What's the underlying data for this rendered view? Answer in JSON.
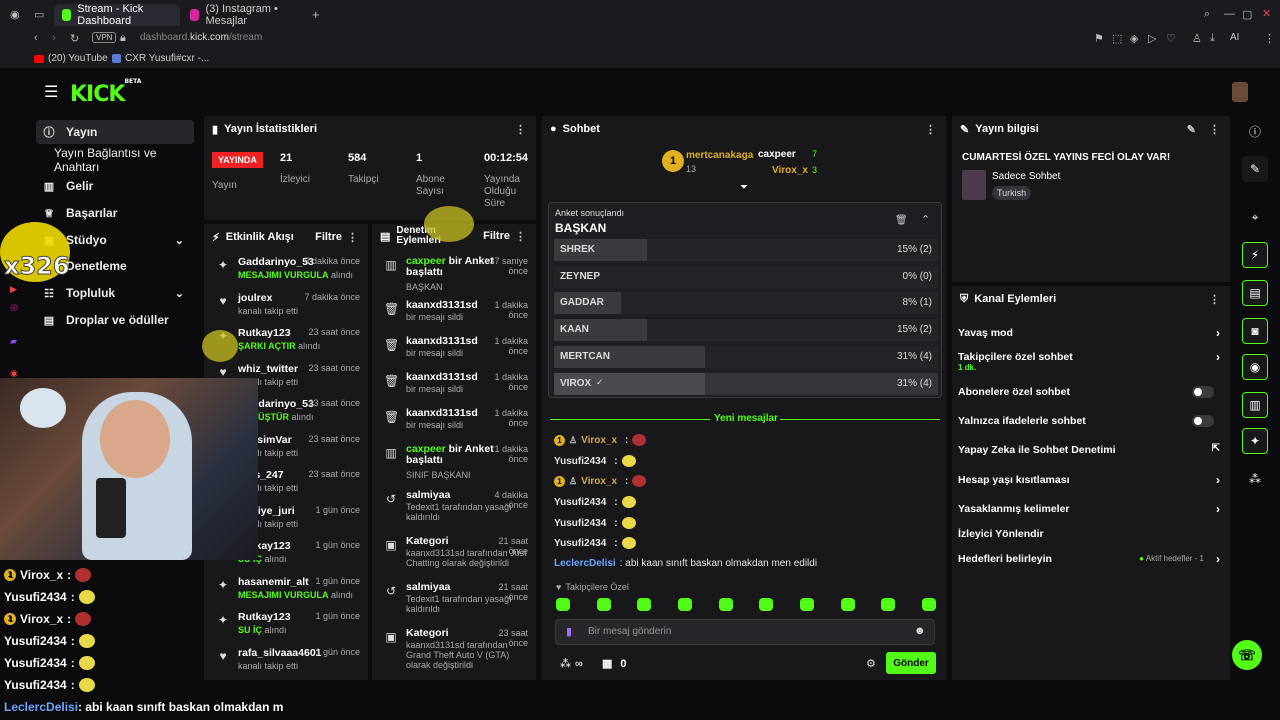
{
  "browser": {
    "tabs": [
      {
        "label": "Stream - Kick Dashboard",
        "active": true,
        "color": "#53fc18"
      },
      {
        "label": "(3) Instagram • Mesajlar",
        "active": false,
        "color": "#d6249f"
      }
    ],
    "vpn": "VPN",
    "url_host": "dashboard.",
    "url_domain": "kick.com",
    "url_path": "/stream",
    "ai_label": "AI",
    "bookmarks": [
      "(20) YouTube",
      "CXR Yusufi#cxr -..."
    ]
  },
  "kick": {
    "logo": "KICK",
    "beta": "BETA"
  },
  "sidebar": {
    "items": [
      {
        "label": "Yayın",
        "icon": "info-icon"
      },
      {
        "label": "Yayın Bağlantısı ve Anahtarı",
        "icon": ""
      },
      {
        "label": "Gelir",
        "icon": "chart-icon"
      },
      {
        "label": "Başarılar",
        "icon": "trophy-icon"
      },
      {
        "label": "Stüdyo",
        "icon": "studio-icon"
      },
      {
        "label": "Denetleme",
        "icon": "shield-icon"
      },
      {
        "label": "Topluluk",
        "icon": "community-icon"
      },
      {
        "label": "Droplar ve ödüller",
        "icon": "gift-icon"
      }
    ]
  },
  "stats": {
    "title": "Yayın İstatistikleri",
    "live_badge": "YAYINDA",
    "live_label": "Yayın",
    "items": [
      {
        "value": "21",
        "label": "İzleyici"
      },
      {
        "value": "584",
        "label": "Takipçi"
      },
      {
        "value": "1",
        "label": "Abone Sayısı"
      },
      {
        "value": "00:12:54",
        "label": "Yayında Olduğu Süre"
      }
    ]
  },
  "activity": {
    "title": "Etkinlik Akışı",
    "filter": "Filtre",
    "rows": [
      {
        "name": "Gaddarinyo_53",
        "time": "5 dakika önce",
        "sub": "MESAJIMI VURGULA",
        "sub2": " alındı",
        "icon": "gift-icon"
      },
      {
        "name": "joulrex",
        "time": "7 dakika önce",
        "sub": "",
        "sub2": "kanalı takip etti",
        "icon": "heart-icon"
      },
      {
        "name": "Rutkay123",
        "time": "23 saat önce",
        "sub": "ŞARKI AÇTIR",
        "sub2": " alındı",
        "icon": "gift-icon"
      },
      {
        "name": "whiz_twitter",
        "time": "23 saat önce",
        "sub": "",
        "sub2": "kanalı takip etti",
        "icon": "heart-icon"
      },
      {
        "name": "Gaddarinyo_53",
        "time": "23 saat önce",
        "sub": "DÖNÜŞTÜR",
        "sub2": " alındı",
        "icon": "gift-icon"
      },
      {
        "name": "PipisimVar",
        "time": "23 saat önce",
        "sub": "",
        "sub2": "kanalı takip etti",
        "icon": "heart-icon"
      },
      {
        "name": "ross_247",
        "time": "23 saat önce",
        "sub": "",
        "sub2": "kanalı takip etti",
        "icon": "heart-icon"
      },
      {
        "name": "turkiye_juri",
        "time": "1 gün önce",
        "sub": "",
        "sub2": "kanalı takip etti",
        "icon": "heart-icon"
      },
      {
        "name": "Rutkay123",
        "time": "1 gün önce",
        "sub": "SU İÇ",
        "sub2": " alındı",
        "icon": "gift-icon"
      },
      {
        "name": "hasanemir_alt",
        "time": "1 gün önce",
        "sub": "MESAJIMI VURGULA",
        "sub2": " alındı",
        "icon": "gift-icon"
      },
      {
        "name": "Rutkay123",
        "time": "1 gün önce",
        "sub": "SU İÇ",
        "sub2": " alındı",
        "icon": "gift-icon"
      },
      {
        "name": "rafa_silvaaa4601",
        "time": "1 gün önce",
        "sub": "",
        "sub2": "kanalı takip etti",
        "icon": "heart-icon"
      }
    ]
  },
  "moderation": {
    "title": "Denetim Eylemleri",
    "filter": "Filtre",
    "rows": [
      {
        "name": "caxpeer",
        "rest": " bir Anket başlattı",
        "time": "37 saniye önce",
        "sub": "BAŞKAN",
        "icon": "poll-icon",
        "h": 44
      },
      {
        "name": "kaanxd3131sd",
        "rest": "",
        "time": "1 dakika önce",
        "sub": "bir mesajı sildi",
        "icon": "trash-icon",
        "h": 36
      },
      {
        "name": "kaanxd3131sd",
        "rest": "",
        "time": "1 dakika önce",
        "sub": "bir mesajı sildi",
        "icon": "trash-icon",
        "h": 36
      },
      {
        "name": "kaanxd3131sd",
        "rest": "",
        "time": "1 dakika önce",
        "sub": "bir mesajı sildi",
        "icon": "trash-icon",
        "h": 36
      },
      {
        "name": "kaanxd3131sd",
        "rest": "",
        "time": "1 dakika önce",
        "sub": "bir mesajı sildi",
        "icon": "trash-icon",
        "h": 36
      },
      {
        "name": "caxpeer",
        "rest": " bir Anket başlattı",
        "time": "1 dakika önce",
        "sub": "SINIF BAŞKANI",
        "icon": "poll-icon",
        "h": 46
      },
      {
        "name": "salmiyaa",
        "rest": "",
        "time": "4 dakika önce",
        "sub": "Tedexit1 tarafından yasağı kaldırıldı",
        "icon": "undo-icon",
        "h": 46
      },
      {
        "name": "Kategori",
        "rest": "",
        "time": "21 saat önce",
        "sub": "kaanxd3131sd tarafından Just Chatting olarak değiştirildi",
        "icon": "category-icon",
        "h": 46
      },
      {
        "name": "salmiyaa",
        "rest": "",
        "time": "21 saat önce",
        "sub": "Tedexit1 tarafından yasağı kaldırıldı",
        "icon": "undo-icon",
        "h": 46
      },
      {
        "name": "Kategori",
        "rest": "",
        "time": "23 saat önce",
        "sub": "kaanxd3131sd tarafından Grand Theft Auto V (GTA) olarak değiştirildi",
        "icon": "category-icon",
        "h": 50
      }
    ]
  },
  "chat": {
    "title": "Sohbet",
    "top_gifters": [
      {
        "name": "mertcanakaga",
        "count": "13"
      },
      {
        "name": "caxpeer",
        "count": "7"
      },
      {
        "name": "Virox_x",
        "count": "3"
      }
    ],
    "poll": {
      "status": "Anket sonuçlandı",
      "title": "BAŞKAN",
      "options": [
        {
          "name": "SHREK",
          "pct": 15,
          "label": "15% (2)"
        },
        {
          "name": "ZEYNEP",
          "pct": 0,
          "label": "0% (0)"
        },
        {
          "name": "GADDAR",
          "pct": 8,
          "label": "8% (1)"
        },
        {
          "name": "KAAN",
          "pct": 15,
          "label": "15% (2)"
        },
        {
          "name": "MERTCAN",
          "pct": 31,
          "label": "31% (4)"
        },
        {
          "name": "VIROX",
          "pct": 31,
          "label": "31% (4)",
          "winner": true
        }
      ]
    },
    "new_messages": "Yeni mesajlar",
    "messages": [
      {
        "user": "Virox_x",
        "color": "#d6a84a",
        "text": "",
        "badge": true
      },
      {
        "user": "Yusufi2434",
        "color": "#e6e6e6",
        "text": "",
        "badge": false
      },
      {
        "user": "Virox_x",
        "color": "#d6a84a",
        "text": "",
        "badge": true
      },
      {
        "user": "Yusufi2434",
        "color": "#e6e6e6",
        "text": "",
        "badge": false
      },
      {
        "user": "Yusufi2434",
        "color": "#e6e6e6",
        "text": "",
        "badge": false
      },
      {
        "user": "Yusufi2434",
        "color": "#e6e6e6",
        "text": "",
        "badge": false
      },
      {
        "user": "LeclercDelisi",
        "color": "#6aa8ff",
        "text": ": abi kaan sınıft baskan olmakdan men edildi",
        "badge": false
      }
    ],
    "followers_only": "Takipçilere Özel",
    "input_placeholder": "Bir mesaj gönderin",
    "points": "∞",
    "coins": "0",
    "send": "Gönder"
  },
  "info": {
    "title": "Yayın bilgisi",
    "stream_title": "CUMARTESİ ÖZEL YAYINS FECİ OLAY VAR!",
    "category": "Sadece Sohbet",
    "language": "Turkish"
  },
  "channel_actions": {
    "title": "Kanal Eylemleri",
    "items": [
      {
        "label": "Yavaş mod",
        "control": "arrow"
      },
      {
        "label": "Takipçilere özel sohbet",
        "control": "arrow",
        "sub": "1 dk."
      },
      {
        "label": "Abonelere özel sohbet",
        "control": "toggle"
      },
      {
        "label": "Yalnızca ifadelerle sohbet",
        "control": "toggle"
      },
      {
        "label": "Yapay Zeka ile Sohbet Denetimi",
        "control": "external"
      },
      {
        "label": "Hesap yaşı kısıtlaması",
        "control": "arrow"
      },
      {
        "label": "Yasaklanmış kelimeler",
        "control": "arrow"
      },
      {
        "label": "İzleyici Yönlendir",
        "control": "none"
      },
      {
        "label": "Hedefleri belirleyin",
        "control": "arrow",
        "sub_right": "Aktif hedefler - 1"
      }
    ]
  },
  "overlay": {
    "combo": "x326",
    "chat": [
      {
        "user": "Virox_x",
        "badge": true
      },
      {
        "user": "Yusufi2434",
        "badge": false
      },
      {
        "user": "Virox_x",
        "badge": true
      },
      {
        "user": "Yusufi2434",
        "badge": false
      },
      {
        "user": "Yusufi2434",
        "badge": false
      },
      {
        "user": "Yusufi2434",
        "badge": false
      }
    ],
    "bottom_user": "LeclercDelisi",
    "bottom_text": ": abi kaan sınıft baskan olmakdan m"
  }
}
